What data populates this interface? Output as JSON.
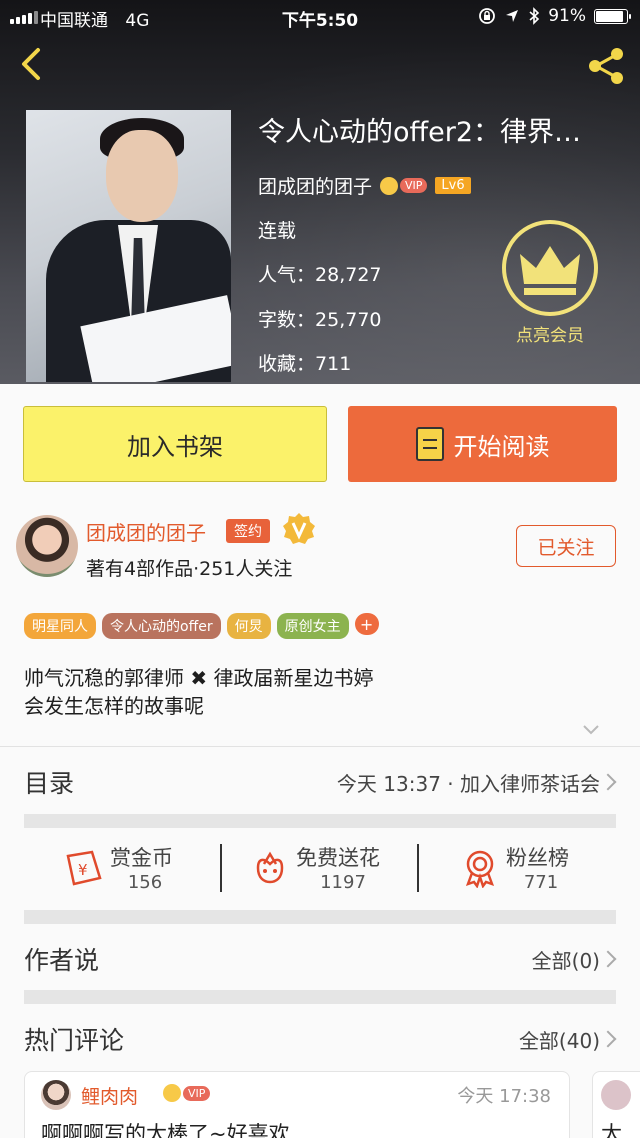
{
  "status_bar": {
    "carrier": "中国联通",
    "network": "4G",
    "time": "下午5:50",
    "battery_percent": "91%",
    "battery_level": 0.91
  },
  "nav": {
    "back_icon": "chevron-left-icon",
    "share_icon": "share-icon"
  },
  "book": {
    "title": "令人心动的offer2：律界…",
    "author": "团成团的团子",
    "vip_label": "VIP",
    "level": "Lv6",
    "status": "连载",
    "popularity_label": "人气：",
    "popularity": "28,727",
    "words_label": "字数：",
    "words": "25,770",
    "favorites_label": "收藏：",
    "favorites": "711",
    "member_label": "点亮会员"
  },
  "actions": {
    "add_shelf": "加入书架",
    "start_read": "开始阅读"
  },
  "author_card": {
    "name": "团成团的团子",
    "sign_tag": "签约",
    "stats": "著有4部作品·251人关注",
    "follow_label": "已关注"
  },
  "tags": [
    {
      "label": "明星同人",
      "color": "#f3a63a"
    },
    {
      "label": "令人心动的offer",
      "color": "#b9735e"
    },
    {
      "label": "何炅",
      "color": "#e8b341"
    },
    {
      "label": "原创女主",
      "color": "#8cb34f"
    }
  ],
  "tag_add": "+",
  "intro": {
    "line1": "帅气沉稳的郭律师 ✖ 律政届新星边书婷",
    "line2": "会发生怎样的故事呢"
  },
  "catalog": {
    "title": "目录",
    "latest": "今天 13:37 · 加入律师茶话会"
  },
  "stats": [
    {
      "label": "赏金币",
      "value": "156",
      "icon": "reward-coin-icon"
    },
    {
      "label": "免费送花",
      "value": "1197",
      "icon": "flower-icon"
    },
    {
      "label": "粉丝榜",
      "value": "771",
      "icon": "medal-icon"
    }
  ],
  "author_says": {
    "title": "作者说",
    "all_label": "全部(0)"
  },
  "hot_comments": {
    "title": "热门评论",
    "all_label": "全部(40)",
    "first": {
      "name": "鲤肉肉",
      "vip_label": "VIP",
      "time": "今天 17:38",
      "text": "啊啊啊写的太棒了~好喜欢"
    },
    "peek_text": "太"
  },
  "colors": {
    "accent_orange": "#ed6a3c",
    "shelf_yellow": "#fbf26a",
    "crown_yellow": "#f2e27a"
  }
}
